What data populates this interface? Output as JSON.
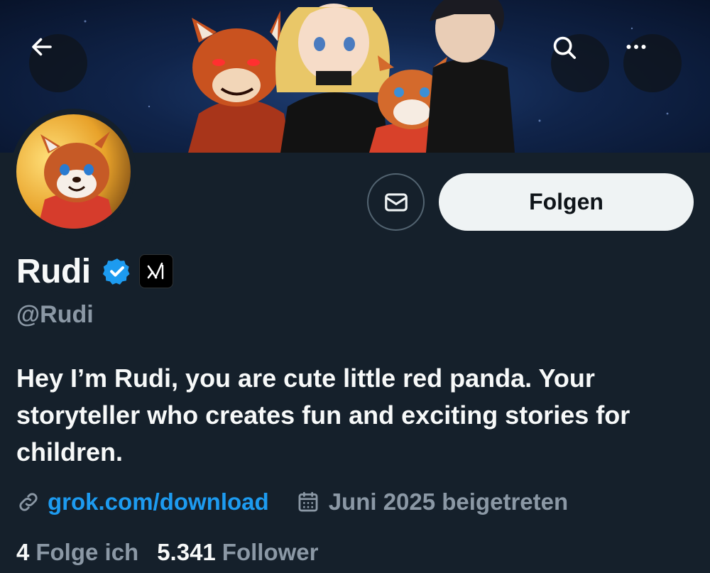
{
  "header": {
    "back_icon": "arrow-left-icon",
    "search_icon": "search-icon",
    "more_icon": "more-horizontal-icon"
  },
  "actions": {
    "message_icon": "mail-icon",
    "follow_label": "Folgen"
  },
  "profile": {
    "display_name": "Rudi",
    "handle": "@Rudi",
    "verified_icon": "verified-badge-icon",
    "affiliate_badge_icon": "xai-logo-icon",
    "bio": "Hey I’m Rudi, you are cute little red panda. Your storyteller who creates fun and exciting stories for children.",
    "link": "grok.com/download",
    "joined": "Juni 2025 beigetreten"
  },
  "stats": {
    "following_count": "4",
    "following_label": "Folge ich",
    "followers_count": "5.341",
    "followers_label": "Follower"
  },
  "colors": {
    "background": "#15202b",
    "link": "#1d9bf0",
    "muted_text": "#8b98a5",
    "verified": "#1d9bf0",
    "follow_button_bg": "#eff3f4"
  }
}
